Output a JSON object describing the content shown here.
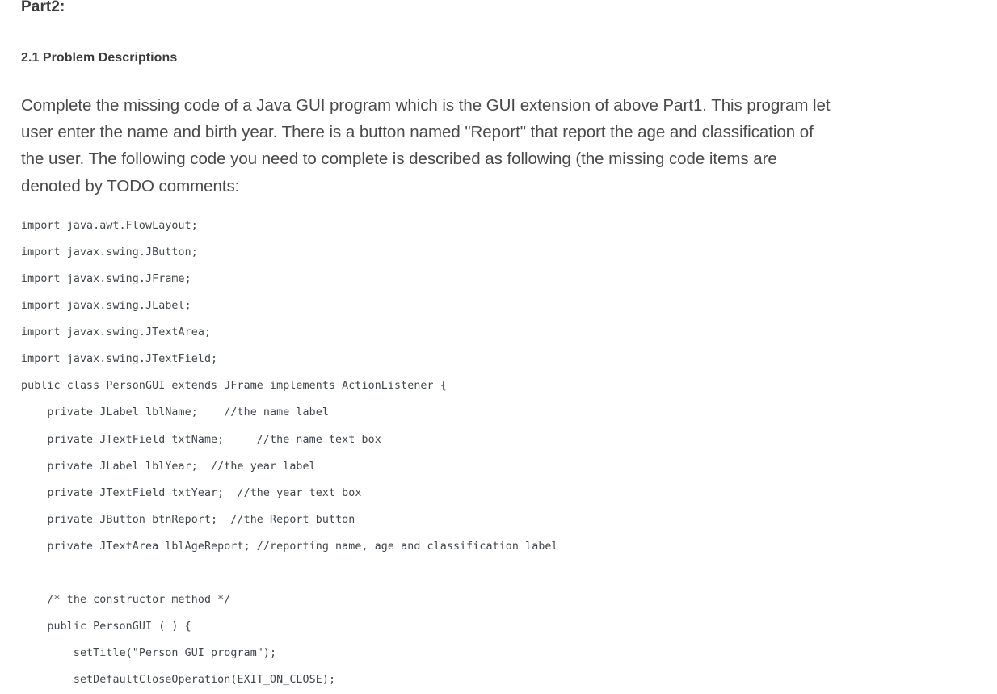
{
  "document": {
    "background_color": "#ffffff",
    "heading_color": "#3c3c3c",
    "body_text_color": "#4a4a4a",
    "code_text_color": "#40464b"
  },
  "headings": {
    "part_title": "Part2:",
    "section_title": "2.1 Problem Descriptions"
  },
  "paragraph": {
    "text": "Complete the missing code of a Java GUI program which is the GUI extension of above Part1. This program let user enter the name and birth year. There is a button named \"Report\" that report the age and classification of the user. The following code you need to complete is described as following (the missing code items are denoted by TODO comments:"
  },
  "code": {
    "language": "java",
    "lines": [
      "import java.awt.FlowLayout;",
      "import javax.swing.JButton;",
      "import javax.swing.JFrame;",
      "import javax.swing.JLabel;",
      "import javax.swing.JTextArea;",
      "import javax.swing.JTextField;",
      "public class PersonGUI extends JFrame implements ActionListener {",
      "    private JLabel lblName;    //the name label",
      "    private JTextField txtName;     //the name text box",
      "    private JLabel lblYear;  //the year label",
      "    private JTextField txtYear;  //the year text box",
      "    private JButton btnReport;  //the Report button",
      "    private JTextArea lblAgeReport; //reporting name, age and classification label",
      "",
      "    /* the constructor method */",
      "    public PersonGUI ( ) {",
      "        setTitle(\"Person GUI program\");",
      "        setDefaultCloseOperation(EXIT_ON_CLOSE);"
    ]
  }
}
